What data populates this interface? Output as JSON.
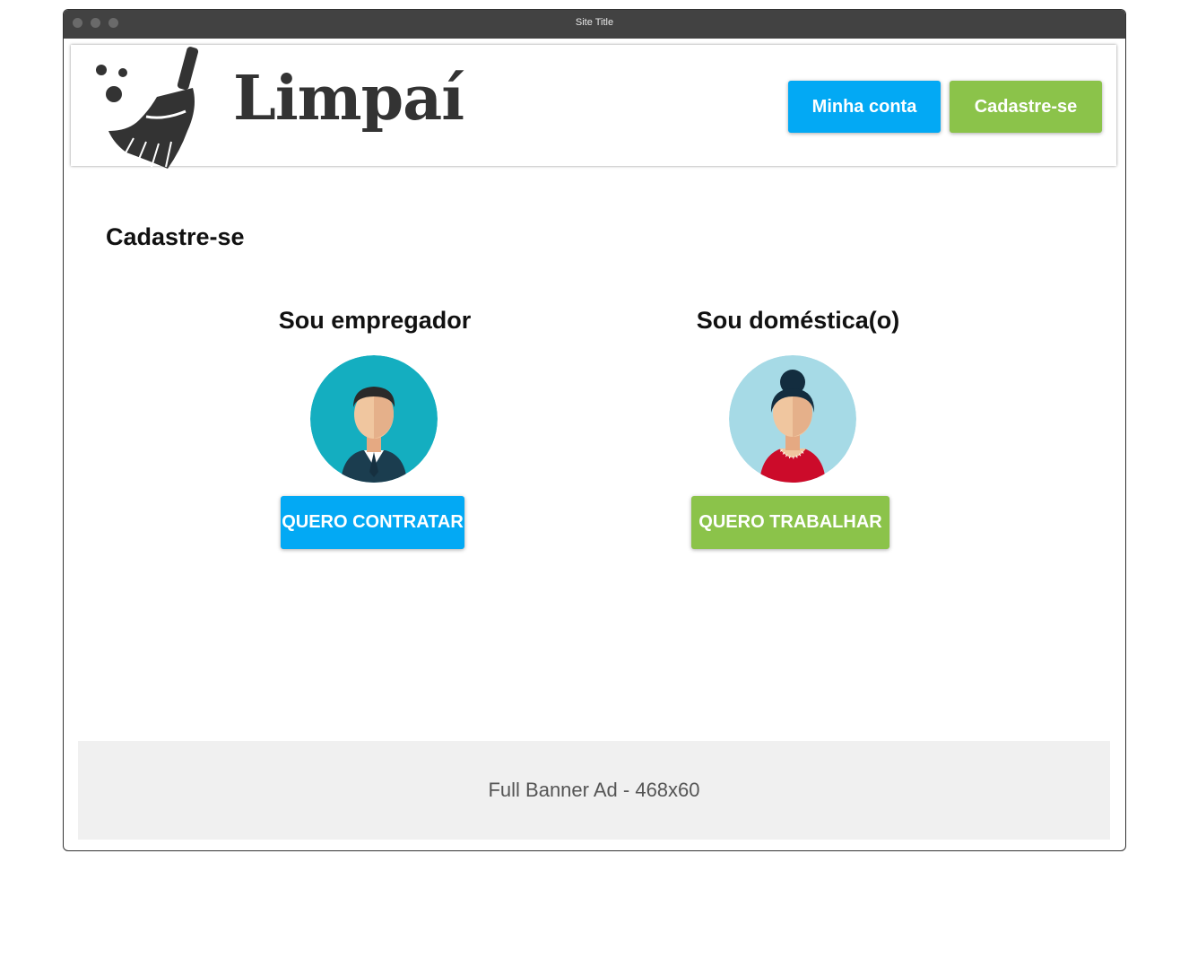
{
  "window": {
    "title": "Site Title"
  },
  "header": {
    "logo_text": "Limpaí",
    "logo_icon": "broom-icon",
    "nav": {
      "account_label": "Minha conta",
      "signup_label": "Cadastre-se"
    }
  },
  "main": {
    "heading": "Cadastre-se",
    "employer": {
      "title": "Sou empregador",
      "avatar": "businessman-avatar",
      "button_label": "QUERO CONTRATAR"
    },
    "housekeeper": {
      "title": "Sou doméstica(o)",
      "avatar": "woman-avatar",
      "button_label": "QUERO TRABALHAR"
    }
  },
  "ad": {
    "label": "Full Banner Ad - 468x60"
  },
  "colors": {
    "blue": "#03a9f4",
    "green": "#8bc34a",
    "titlebar": "#424242"
  }
}
